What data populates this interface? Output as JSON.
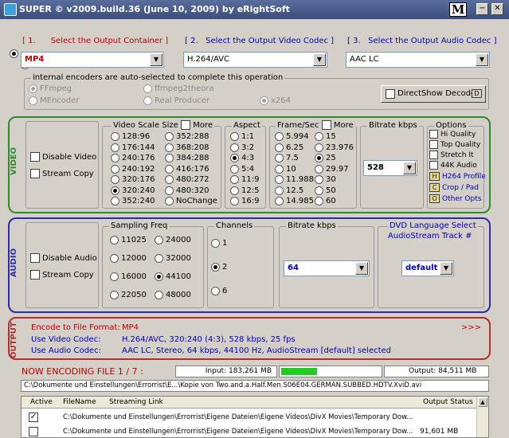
{
  "window": {
    "title": "SUPER © v2009.build.36 (June 10, 2009) by eRightSoft",
    "logo": "M",
    "min": "−",
    "close": "✕"
  },
  "containers": {
    "container": {
      "num": "[ 1.",
      "label": "Select the Output Container ]",
      "value": "MP4"
    },
    "video_codec": {
      "num": "[ 2.",
      "label": "Select the Output Video Codec ]",
      "value": "H.264/AVC"
    },
    "audio_codec": {
      "num": "[ 3.",
      "label": "Select the Output Audio Codec ]",
      "value": "AAC LC"
    }
  },
  "encoders": {
    "legend": "internal encoders are auto-selected to complete this operation",
    "items": [
      "FFmpeg",
      "MEncoder",
      "ffmpeg2theora",
      "Real Producer",
      "x264"
    ],
    "directshow": "DirectShow Decode",
    "directshow_btn": "D"
  },
  "video": {
    "section_label": "VIDEO",
    "disable": "Disable Video",
    "stream_copy": "Stream Copy",
    "scale_title": "Video Scale Size",
    "more": "More",
    "scale_col1": [
      "128:96",
      "176:144",
      "240:176",
      "240:192",
      "320:176",
      "320:240",
      "352:240"
    ],
    "scale_col2": [
      "352:288",
      "368:208",
      "384:288",
      "416:176",
      "480:272",
      "480:320",
      "NoChange"
    ],
    "scale_selected": "320:240",
    "aspect_title": "Aspect",
    "aspect": [
      "1:1",
      "3:2",
      "4:3",
      "5:4",
      "11:9",
      "12:5",
      "16:9"
    ],
    "aspect_selected": "4:3",
    "fps_title": "Frame/Sec",
    "fps_more": "More",
    "fps_col1": [
      "5.994",
      "6.25",
      "7.5",
      "10",
      "11.988",
      "12.5",
      "14.985"
    ],
    "fps_col2": [
      "15",
      "23.976",
      "25",
      "29.97",
      "30",
      "50",
      "60"
    ],
    "fps_selected": "25",
    "bitrate_title": "Bitrate  kbps",
    "bitrate": "528",
    "options_title": "Options",
    "options": [
      "Hi Quality",
      "Top Quality",
      "Stretch It",
      "44K Audio"
    ],
    "opt_buttons": [
      {
        "key": "H",
        "label": "H264 Profile"
      },
      {
        "key": "C",
        "label": "Crop / Pad"
      },
      {
        "key": "O",
        "label": "Other Opts"
      }
    ]
  },
  "audio": {
    "section_label": "AUDIO",
    "disable": "Disable Audio",
    "stream_copy": "Stream Copy",
    "freq_title": "Sampling Freq",
    "freqs": [
      "11025",
      "24000",
      "12000",
      "32000",
      "16000",
      "44100",
      "22050",
      "48000"
    ],
    "freq_selected": "44100",
    "channels_title": "Channels",
    "channels": [
      "1",
      "2",
      "6"
    ],
    "channel_selected": "2",
    "bitrate_title": "Bitrate  kbps",
    "bitrate": "64",
    "dvd_title": "DVD Language Select",
    "dvd_sub": "AudioStream  Track #",
    "dvd_value": "default"
  },
  "output": {
    "section_label": "OUTPUT",
    "format_label": "Encode to File Format:",
    "format_value": "MP4",
    "video_label": "Use Video Codec:",
    "video_value": "H.264/AVC,  320:240 (4:3),  528 kbps,  25 fps",
    "audio_label": "Use Audio Codec:",
    "audio_value": "AAC LC,  Stereo,  64 kbps,  44100 Hz,  AudioStream [default] selected",
    "arrows": ">>>"
  },
  "encoding": {
    "status": "NOW ENCODING FILE 1 / 7 :",
    "input": "Input: 183,261 MB",
    "output": "Output: 84,511 MB",
    "progress": 0.36,
    "path": "C:\\Dokumente und Einstellungen\\Errorrist\\E...\\Kopie von Two.and.a.Half.Men.S06E04.GERMAN.SUBBED.HDTV.XviD.avi"
  },
  "filelist": {
    "headers": [
      "Active",
      "FileName",
      "Streaming Link",
      "Output Status"
    ],
    "rows": [
      {
        "active": true,
        "name": "C:\\Dokumente und Einstellungen\\Errorrist\\Eigene Dateien\\Eigene Videos\\DivX Movies\\Temporary Dow...",
        "status": ""
      },
      {
        "active": false,
        "name": "C:\\Dokumente und Einstellungen\\Errorrist\\Eigene Dateien\\Eigene Videos\\DivX Movies\\Temporary Dow...",
        "status": "91,601 MB"
      }
    ]
  }
}
